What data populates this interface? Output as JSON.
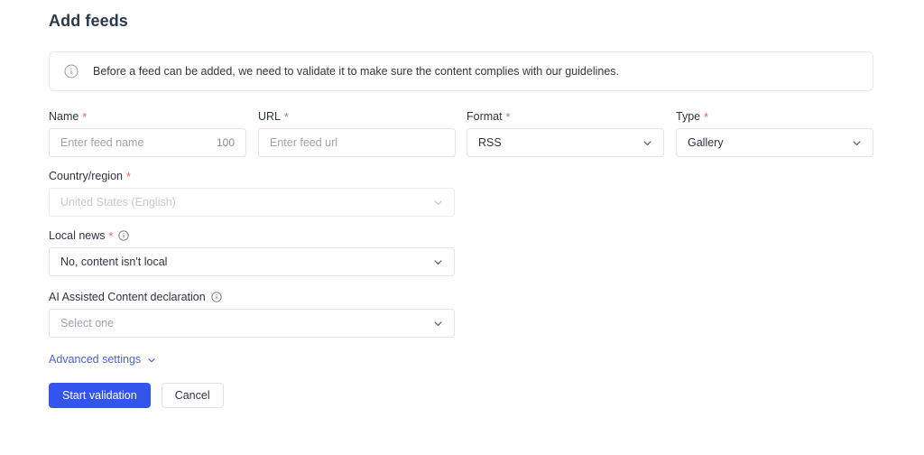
{
  "page": {
    "title": "Add feeds"
  },
  "banner": {
    "icon": "info-circle-icon",
    "text": "Before a feed can be added, we need to validate it to make sure the content complies with our guidelines."
  },
  "form": {
    "fields": [
      {
        "key": "name",
        "label": "Name",
        "required": true,
        "required_marker": "*",
        "control": "text-input",
        "value": "",
        "placeholder": "Enter feed name",
        "counter": "100",
        "disabled": false
      },
      {
        "key": "url",
        "label": "URL",
        "required": true,
        "required_marker": "*",
        "control": "text-input",
        "value": "",
        "placeholder": "Enter feed url",
        "disabled": false
      },
      {
        "key": "format",
        "label": "Format",
        "required": true,
        "required_marker": "*",
        "control": "select",
        "value": "RSS",
        "disabled": false
      },
      {
        "key": "type",
        "label": "Type",
        "required": true,
        "required_marker": "*",
        "control": "select",
        "value": "Gallery",
        "disabled": false
      },
      {
        "key": "country",
        "label": "Country/region",
        "required": true,
        "required_marker": "*",
        "control": "select",
        "value": "United States (English)",
        "disabled": true
      },
      {
        "key": "local_news",
        "label": "Local news",
        "required": true,
        "required_marker": "*",
        "info_icon": "info-circle-icon",
        "control": "select",
        "value": "No, content isn't local",
        "disabled": false
      },
      {
        "key": "ai_declaration",
        "label": "AI Assisted Content declaration",
        "required": false,
        "info_icon": "info-circle-icon",
        "control": "select",
        "value": "",
        "placeholder": "Select one",
        "disabled": false
      }
    ],
    "advanced_settings": {
      "label": "Advanced settings",
      "icon": "chevron-down-icon",
      "expanded": false
    },
    "actions": {
      "primary": "Start validation",
      "secondary": "Cancel"
    }
  },
  "colors": {
    "primary_button": "#3355ee",
    "link": "#4d5fe8",
    "required_asterisk": "#e05c6e",
    "border": "#e3e3e8",
    "text": "#2e3340",
    "placeholder": "#a0a2ad",
    "disabled_text": "#c6c8d2",
    "background": "#ffffff"
  }
}
